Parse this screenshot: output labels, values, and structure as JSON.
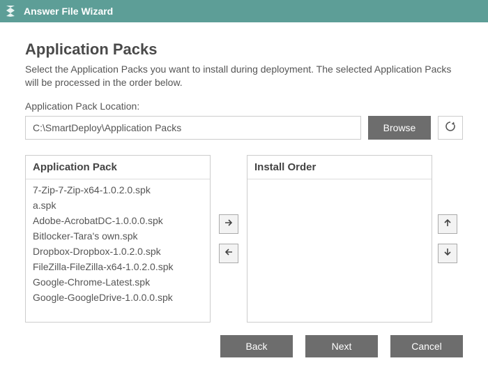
{
  "title": "Answer File Wizard",
  "heading": "Application Packs",
  "description": "Select the Application Packs you want to install during deployment. The selected Application Packs will be processed in the order below.",
  "location": {
    "label": "Application Pack Location:",
    "value": "C:\\SmartDeploy\\Application Packs",
    "browse": "Browse"
  },
  "columns": {
    "available": "Application Pack",
    "selected": "Install Order"
  },
  "available_packs": [
    "7-Zip-7-Zip-x64-1.0.2.0.spk",
    "a.spk",
    "Adobe-AcrobatDC-1.0.0.0.spk",
    "Bitlocker-Tara's own.spk",
    "Dropbox-Dropbox-1.0.2.0.spk",
    "FileZilla-FileZilla-x64-1.0.2.0.spk",
    "Google-Chrome-Latest.spk",
    "Google-GoogleDrive-1.0.0.0.spk"
  ],
  "selected_packs": [],
  "footer": {
    "back": "Back",
    "next": "Next",
    "cancel": "Cancel"
  }
}
